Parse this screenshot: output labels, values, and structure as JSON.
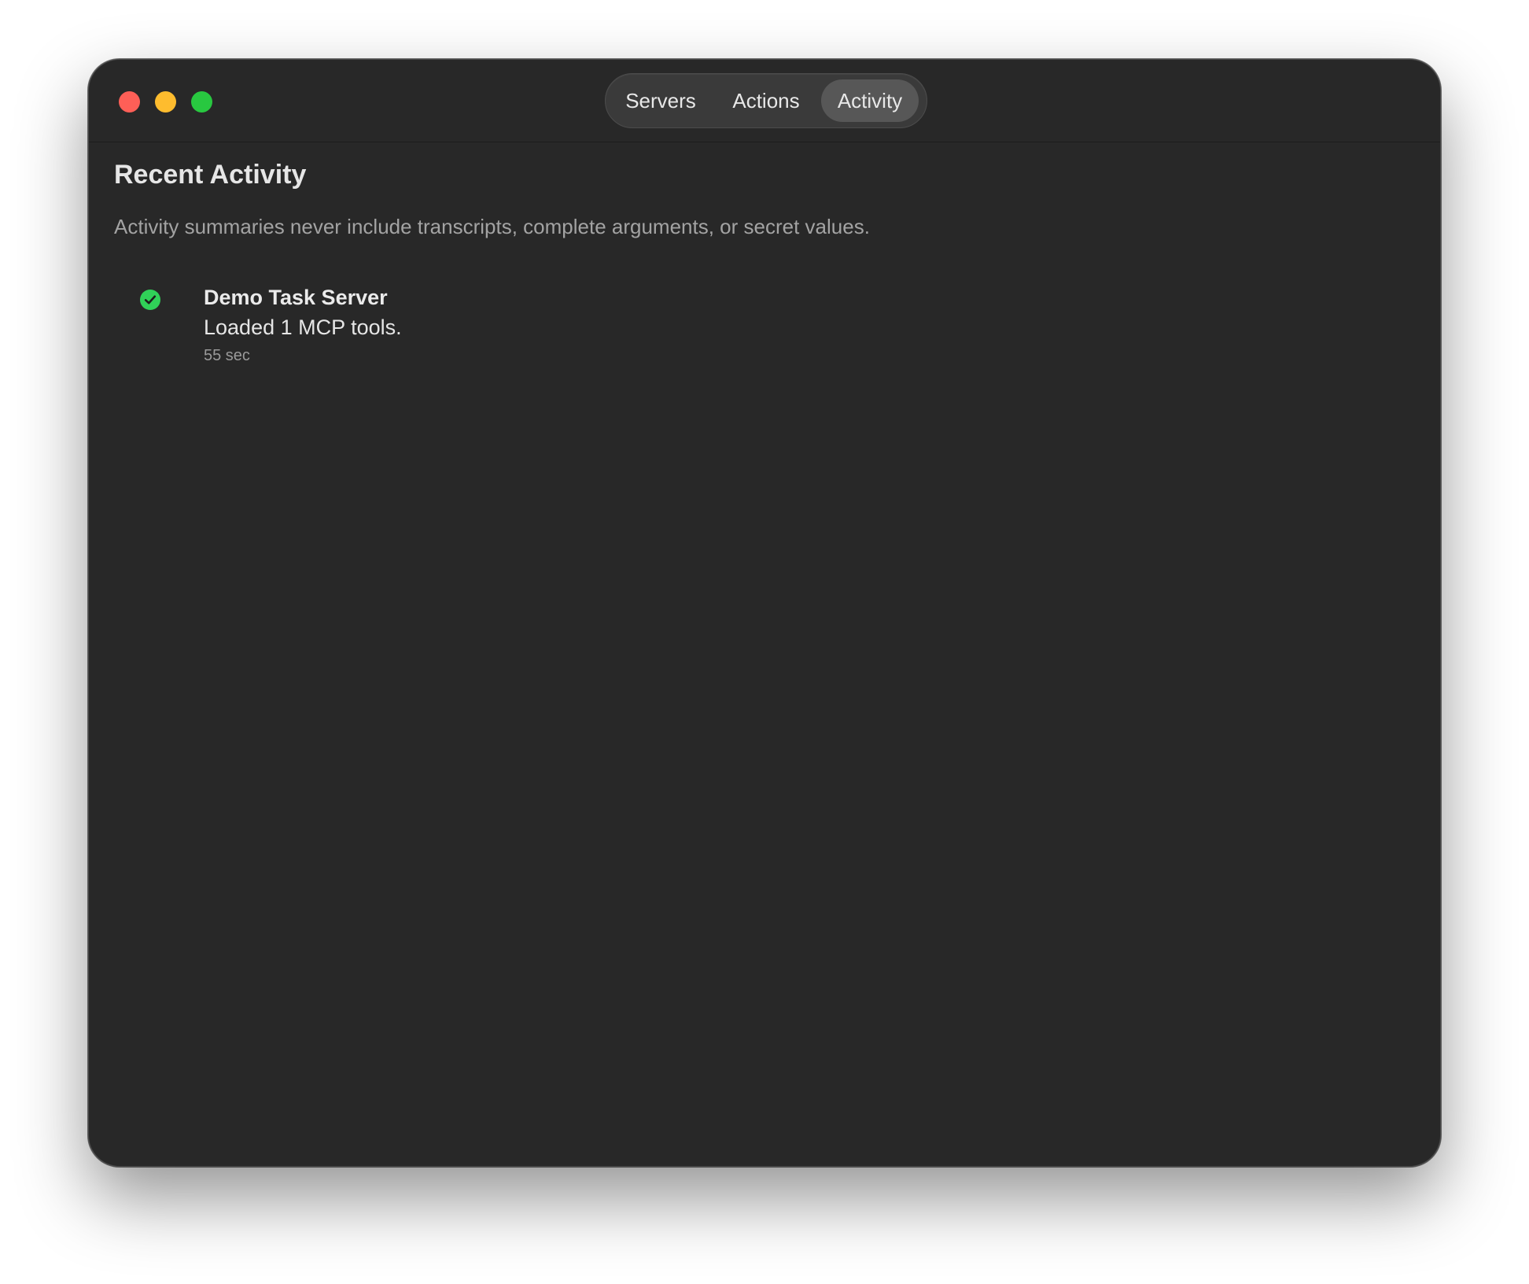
{
  "window": {
    "controls": {
      "close_color": "#fe5f57",
      "minimize_color": "#febc2e",
      "zoom_color": "#28c840"
    }
  },
  "tabs": [
    {
      "label": "Servers",
      "selected": false
    },
    {
      "label": "Actions",
      "selected": false
    },
    {
      "label": "Activity",
      "selected": true
    }
  ],
  "activity": {
    "title": "Recent Activity",
    "subtitle": "Activity summaries never include transcripts, complete arguments, or secret values.",
    "items": [
      {
        "status": "success",
        "status_icon": "checkmark-circle-icon",
        "status_color": "#30d158",
        "title": "Demo Task Server",
        "description": "Loaded 1 MCP tools.",
        "time": "55 sec"
      }
    ]
  }
}
